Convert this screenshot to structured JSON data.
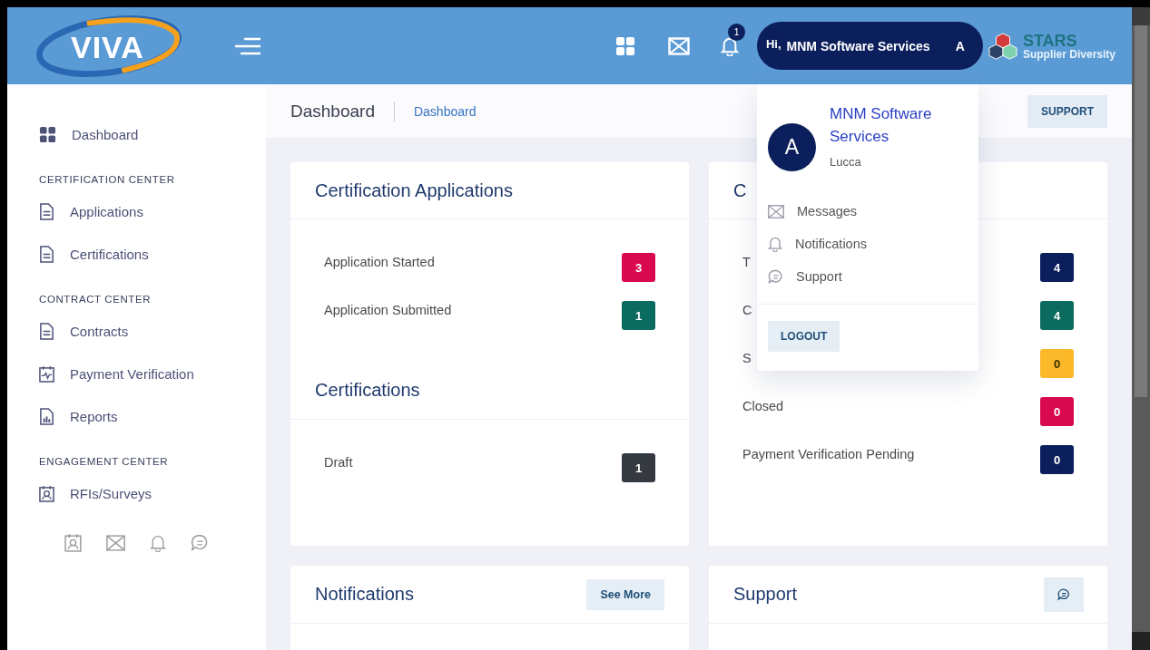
{
  "header": {
    "logo": "VIVA",
    "notification_count": "1",
    "greeting": "Hi,",
    "user_name": "MNM Software Services",
    "user_initial": "A",
    "brand_title": "STARS",
    "brand_subtitle": "Supplier Diversity"
  },
  "sidebar": {
    "dashboard": "Dashboard",
    "sections": [
      {
        "title": "CERTIFICATION CENTER",
        "items": [
          {
            "label": "Applications"
          },
          {
            "label": "Certifications"
          }
        ]
      },
      {
        "title": "CONTRACT CENTER",
        "items": [
          {
            "label": "Contracts"
          },
          {
            "label": "Payment Verification"
          },
          {
            "label": "Reports"
          }
        ]
      },
      {
        "title": "ENGAGEMENT CENTER",
        "items": [
          {
            "label": "RFIs/Surveys"
          }
        ]
      }
    ]
  },
  "breadcrumb": {
    "title": "Dashboard",
    "crumb": "Dashboard",
    "support_button": "SUPPORT"
  },
  "left_card": {
    "sections": [
      {
        "title": "Certification Applications",
        "rows": [
          {
            "label": "Application Started",
            "count": "3",
            "color": "#d8094f"
          },
          {
            "label": "Application Submitted",
            "count": "1",
            "color": "#0b6b5e"
          }
        ]
      },
      {
        "title": "Certifications",
        "rows": [
          {
            "label": "Draft",
            "count": "1",
            "color": "#343a40"
          }
        ]
      }
    ]
  },
  "right_card": {
    "title": "C",
    "rows": [
      {
        "label": "T",
        "count": "4",
        "color": "#0b1f5c"
      },
      {
        "label": "C",
        "count": "4",
        "color": "#0b6b5e"
      },
      {
        "label": "S",
        "count": "0",
        "color": "#fbb829"
      },
      {
        "label": "Closed",
        "count": "0",
        "color": "#d8094f"
      },
      {
        "label": "Payment Verification Pending",
        "count": "0",
        "color": "#0b1f5c"
      }
    ]
  },
  "notifications_card": {
    "title": "Notifications",
    "button": "See More"
  },
  "support_card": {
    "title": "Support"
  },
  "user_menu": {
    "avatar": "A",
    "name": "MNM Software Services",
    "subtitle": "Lucca",
    "items": [
      {
        "label": "Messages"
      },
      {
        "label": "Notifications"
      },
      {
        "label": "Support"
      }
    ],
    "logout": "LOGOUT"
  }
}
